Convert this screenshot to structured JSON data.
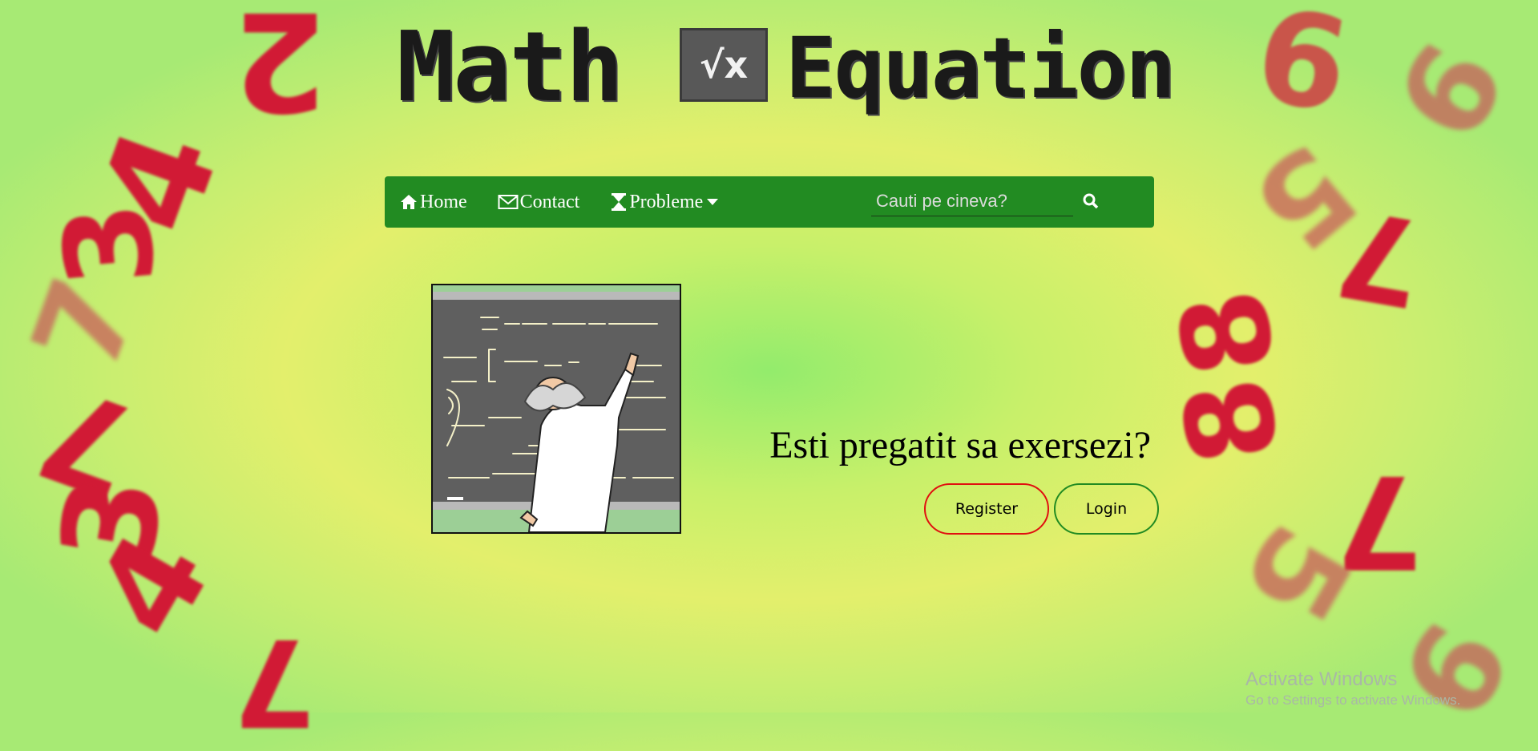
{
  "logo": {
    "word_left": "Math",
    "badge": "√x",
    "word_right": "Equation"
  },
  "nav": {
    "items": [
      {
        "label": "Home",
        "icon": "home-icon"
      },
      {
        "label": "Contact",
        "icon": "envelope-icon"
      },
      {
        "label": "Probleme",
        "icon": "hourglass-icon",
        "dropdown": true
      }
    ],
    "search_placeholder": "Cauti pe cineva?"
  },
  "main": {
    "headline": "Esti pregatit sa exersezi?",
    "register_label": "Register",
    "login_label": "Login"
  },
  "watermark": {
    "title": "Activate Windows",
    "subtitle": "Go to Settings to activate Windows."
  },
  "colors": {
    "nav_bg": "#228b22",
    "register_border": "#e01010",
    "login_border": "#228b22",
    "numbers": "#d11a35"
  },
  "decor_numbers": [
    "2",
    "4",
    "3",
    "7",
    "3",
    "4",
    "7",
    "9",
    "6",
    "5",
    "7",
    "8",
    "8",
    "7",
    "2",
    "5",
    "9"
  ]
}
